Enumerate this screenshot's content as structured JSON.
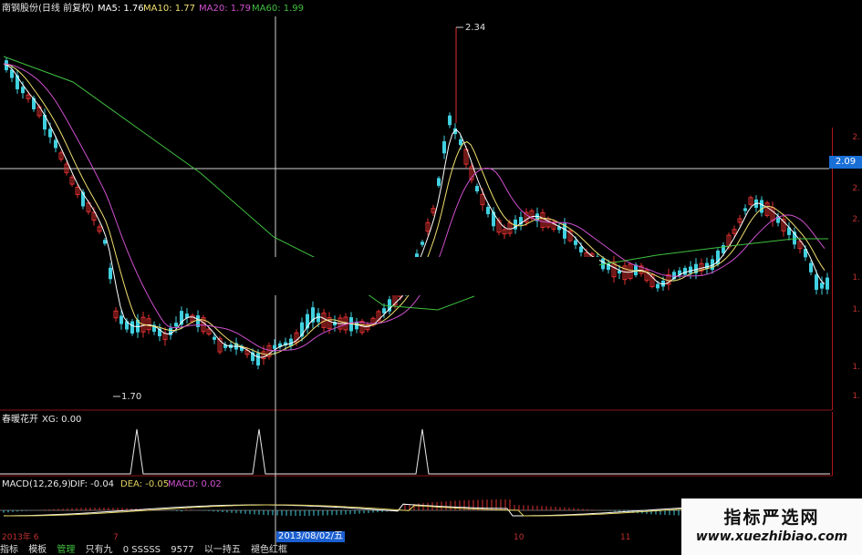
{
  "header": {
    "stock": "南钢股份(日线 前复权)",
    "ma5": "MA5: 1.76",
    "ma10": "MA10: 1.77",
    "ma20": "MA20: 1.79",
    "ma60": "MA60: 1.99",
    "colors": {
      "ma5": "#ffffff",
      "ma10": "#f0e070",
      "ma20": "#d050d0",
      "ma60": "#40c040"
    }
  },
  "price_panel": {
    "high_label": "2.34",
    "low_label": "1.70",
    "crosshair_price": "2.09",
    "axis_ticks": [
      "2.",
      "2.",
      "2.",
      "1.",
      "1.",
      "1.",
      "1."
    ]
  },
  "indicator_panel": {
    "name": "春暖花开",
    "value": "XG: 0.00"
  },
  "macd_panel": {
    "title": "MACD(12,26,9)",
    "dif": "DIF: -0.04",
    "dea": "DEA: -0.05",
    "macd": "MACD: 0.02"
  },
  "time_axis": {
    "year_label": "2013年 6",
    "crosshair_date": "2013/08/02/五",
    "m7": "7",
    "m10": "10",
    "m11": "11"
  },
  "tabs": [
    "指标",
    "模板",
    "管理",
    "只有九",
    "0 SSSSS",
    "9577",
    "以一持五",
    "褪色红框"
  ],
  "watermark": {
    "line1": "指标严选网",
    "line2": "www.xuezhibiao.com"
  }
}
